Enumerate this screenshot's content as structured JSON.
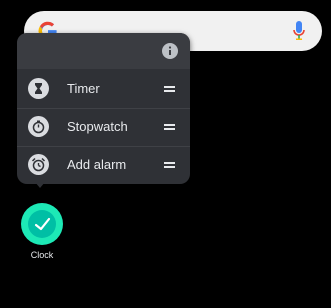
{
  "search": {
    "logo_icon": "google-g-icon",
    "mic_icon": "mic-icon"
  },
  "popup": {
    "info_icon": "info-icon",
    "items": [
      {
        "label": "Timer",
        "icon": "hourglass-icon"
      },
      {
        "label": "Stopwatch",
        "icon": "stopwatch-icon"
      },
      {
        "label": "Add alarm",
        "icon": "alarm-clock-icon"
      }
    ]
  },
  "app": {
    "label": "Clock",
    "icon": "clock-app-icon",
    "icon_color": "#1de9b6"
  },
  "colors": {
    "background": "#000000",
    "popup": "#2f3136",
    "search_bar": "#f1f1f1"
  }
}
